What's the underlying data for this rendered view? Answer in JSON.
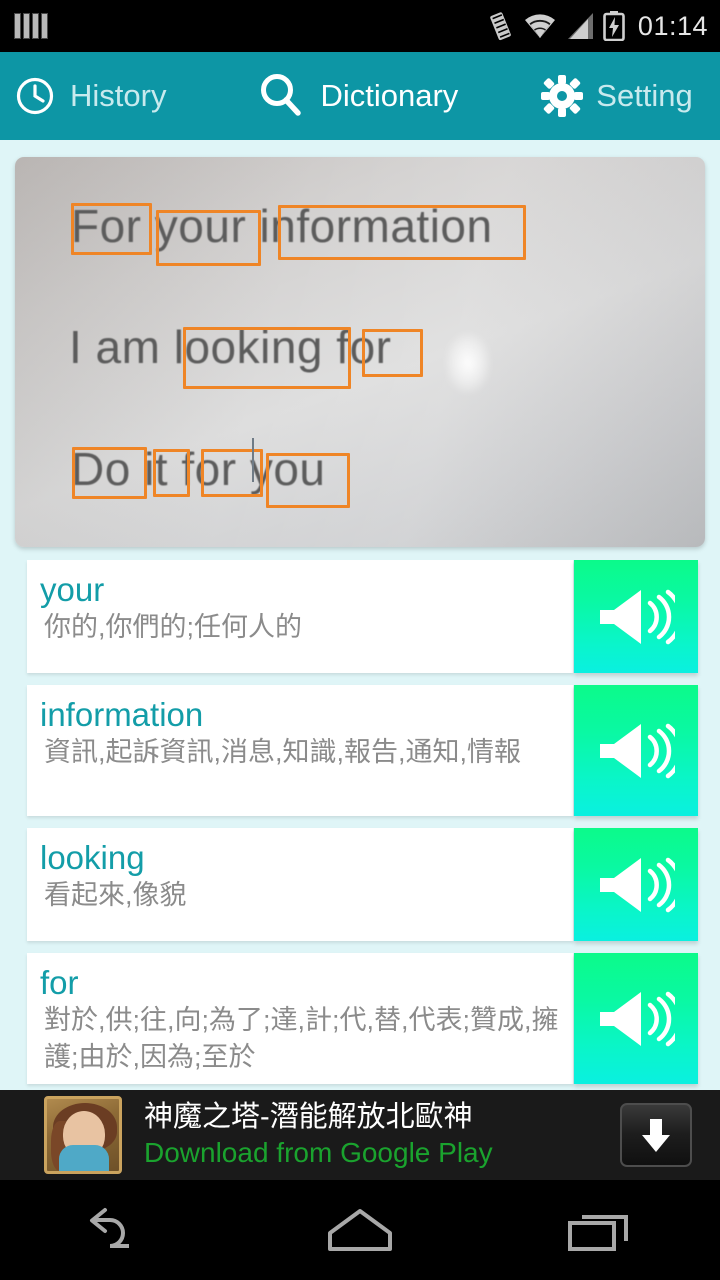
{
  "statusbar": {
    "time": "01:14",
    "icons": [
      "notification-bars-icon",
      "vibrate-icon",
      "wifi-icon",
      "signal-icon",
      "battery-charging-icon"
    ]
  },
  "actionbar": {
    "tabs": [
      {
        "label": "History",
        "icon": "clock-icon"
      },
      {
        "label": "Dictionary",
        "icon": "search-icon"
      },
      {
        "label": "Setting",
        "icon": "gear-icon"
      }
    ]
  },
  "camera": {
    "lines": [
      {
        "text": "For your information"
      },
      {
        "text": "I am looking for"
      },
      {
        "text": "Do it for you"
      }
    ],
    "detected_words": [
      "For",
      "your",
      "information",
      "looking",
      "for",
      "Do",
      "it",
      "for",
      "you"
    ],
    "box_color": "#ef8526"
  },
  "results": [
    {
      "word": "your",
      "definition": "你的,你們的;任何人的",
      "speak_label": "speaker"
    },
    {
      "word": "information",
      "definition": "資訊,起訴資訊,消息,知識,報告,通知,情報",
      "speak_label": "speaker"
    },
    {
      "word": "looking",
      "definition": "看起來,像貌",
      "speak_label": "speaker"
    },
    {
      "word": "for",
      "definition": "對於,供;往,向;為了;達,計;代,替,代表;贊成,擁護;由於,因為;至於",
      "speak_label": "speaker"
    }
  ],
  "ad": {
    "title": "神魔之塔-潛能解放北歐神",
    "subtitle": "Download from Google Play",
    "download_icon": "download-arrow-icon"
  },
  "navbar": {
    "back": "back-icon",
    "home": "home-icon",
    "recents": "recents-icon"
  },
  "colors": {
    "accent_teal": "#0d96a5",
    "word_teal": "#139da8",
    "speaker_green": "#0bfa8a",
    "speaker_cyan": "#0af0e0",
    "page_bg": "#dff5f7",
    "ocr_box": "#ef8526",
    "ad_green": "#1aa32e"
  }
}
